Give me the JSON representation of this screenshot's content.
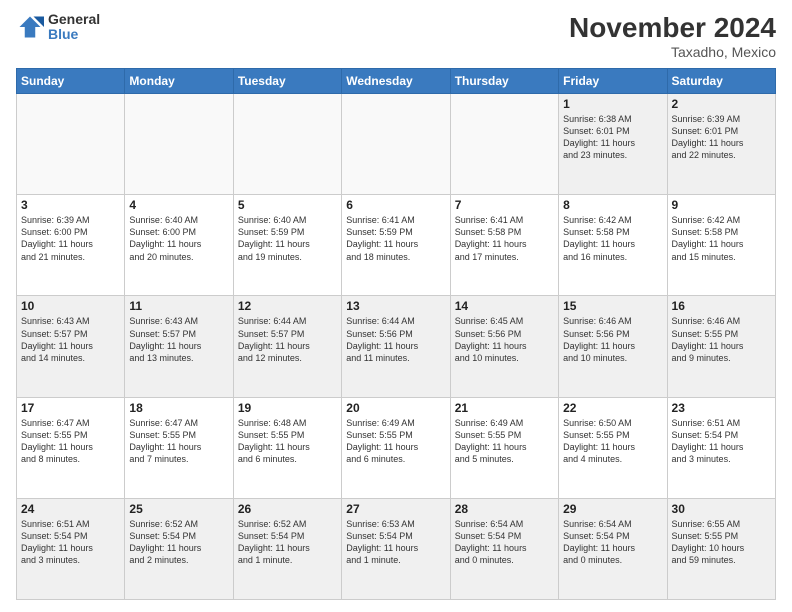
{
  "logo": {
    "general": "General",
    "blue": "Blue"
  },
  "title": "November 2024",
  "location": "Taxadho, Mexico",
  "days_of_week": [
    "Sunday",
    "Monday",
    "Tuesday",
    "Wednesday",
    "Thursday",
    "Friday",
    "Saturday"
  ],
  "weeks": [
    [
      {
        "day": "",
        "info": ""
      },
      {
        "day": "",
        "info": ""
      },
      {
        "day": "",
        "info": ""
      },
      {
        "day": "",
        "info": ""
      },
      {
        "day": "",
        "info": ""
      },
      {
        "day": "1",
        "info": "Sunrise: 6:38 AM\nSunset: 6:01 PM\nDaylight: 11 hours\nand 23 minutes."
      },
      {
        "day": "2",
        "info": "Sunrise: 6:39 AM\nSunset: 6:01 PM\nDaylight: 11 hours\nand 22 minutes."
      }
    ],
    [
      {
        "day": "3",
        "info": "Sunrise: 6:39 AM\nSunset: 6:00 PM\nDaylight: 11 hours\nand 21 minutes."
      },
      {
        "day": "4",
        "info": "Sunrise: 6:40 AM\nSunset: 6:00 PM\nDaylight: 11 hours\nand 20 minutes."
      },
      {
        "day": "5",
        "info": "Sunrise: 6:40 AM\nSunset: 5:59 PM\nDaylight: 11 hours\nand 19 minutes."
      },
      {
        "day": "6",
        "info": "Sunrise: 6:41 AM\nSunset: 5:59 PM\nDaylight: 11 hours\nand 18 minutes."
      },
      {
        "day": "7",
        "info": "Sunrise: 6:41 AM\nSunset: 5:58 PM\nDaylight: 11 hours\nand 17 minutes."
      },
      {
        "day": "8",
        "info": "Sunrise: 6:42 AM\nSunset: 5:58 PM\nDaylight: 11 hours\nand 16 minutes."
      },
      {
        "day": "9",
        "info": "Sunrise: 6:42 AM\nSunset: 5:58 PM\nDaylight: 11 hours\nand 15 minutes."
      }
    ],
    [
      {
        "day": "10",
        "info": "Sunrise: 6:43 AM\nSunset: 5:57 PM\nDaylight: 11 hours\nand 14 minutes."
      },
      {
        "day": "11",
        "info": "Sunrise: 6:43 AM\nSunset: 5:57 PM\nDaylight: 11 hours\nand 13 minutes."
      },
      {
        "day": "12",
        "info": "Sunrise: 6:44 AM\nSunset: 5:57 PM\nDaylight: 11 hours\nand 12 minutes."
      },
      {
        "day": "13",
        "info": "Sunrise: 6:44 AM\nSunset: 5:56 PM\nDaylight: 11 hours\nand 11 minutes."
      },
      {
        "day": "14",
        "info": "Sunrise: 6:45 AM\nSunset: 5:56 PM\nDaylight: 11 hours\nand 10 minutes."
      },
      {
        "day": "15",
        "info": "Sunrise: 6:46 AM\nSunset: 5:56 PM\nDaylight: 11 hours\nand 10 minutes."
      },
      {
        "day": "16",
        "info": "Sunrise: 6:46 AM\nSunset: 5:55 PM\nDaylight: 11 hours\nand 9 minutes."
      }
    ],
    [
      {
        "day": "17",
        "info": "Sunrise: 6:47 AM\nSunset: 5:55 PM\nDaylight: 11 hours\nand 8 minutes."
      },
      {
        "day": "18",
        "info": "Sunrise: 6:47 AM\nSunset: 5:55 PM\nDaylight: 11 hours\nand 7 minutes."
      },
      {
        "day": "19",
        "info": "Sunrise: 6:48 AM\nSunset: 5:55 PM\nDaylight: 11 hours\nand 6 minutes."
      },
      {
        "day": "20",
        "info": "Sunrise: 6:49 AM\nSunset: 5:55 PM\nDaylight: 11 hours\nand 6 minutes."
      },
      {
        "day": "21",
        "info": "Sunrise: 6:49 AM\nSunset: 5:55 PM\nDaylight: 11 hours\nand 5 minutes."
      },
      {
        "day": "22",
        "info": "Sunrise: 6:50 AM\nSunset: 5:55 PM\nDaylight: 11 hours\nand 4 minutes."
      },
      {
        "day": "23",
        "info": "Sunrise: 6:51 AM\nSunset: 5:54 PM\nDaylight: 11 hours\nand 3 minutes."
      }
    ],
    [
      {
        "day": "24",
        "info": "Sunrise: 6:51 AM\nSunset: 5:54 PM\nDaylight: 11 hours\nand 3 minutes."
      },
      {
        "day": "25",
        "info": "Sunrise: 6:52 AM\nSunset: 5:54 PM\nDaylight: 11 hours\nand 2 minutes."
      },
      {
        "day": "26",
        "info": "Sunrise: 6:52 AM\nSunset: 5:54 PM\nDaylight: 11 hours\nand 1 minute."
      },
      {
        "day": "27",
        "info": "Sunrise: 6:53 AM\nSunset: 5:54 PM\nDaylight: 11 hours\nand 1 minute."
      },
      {
        "day": "28",
        "info": "Sunrise: 6:54 AM\nSunset: 5:54 PM\nDaylight: 11 hours\nand 0 minutes."
      },
      {
        "day": "29",
        "info": "Sunrise: 6:54 AM\nSunset: 5:54 PM\nDaylight: 11 hours\nand 0 minutes."
      },
      {
        "day": "30",
        "info": "Sunrise: 6:55 AM\nSunset: 5:55 PM\nDaylight: 10 hours\nand 59 minutes."
      }
    ]
  ]
}
